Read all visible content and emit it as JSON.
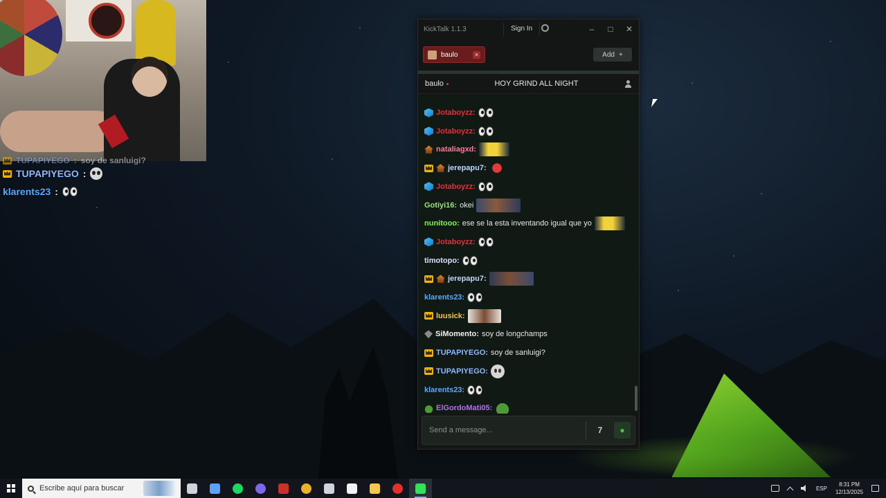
{
  "window": {
    "title": "KickTalk 1.1.3",
    "sign_in": "Sign In",
    "win_minimize": "–",
    "win_maximize": "□",
    "win_close": "✕"
  },
  "tabs": [
    {
      "label": "baulo",
      "close": "×"
    }
  ],
  "add_tab": {
    "label": "Add",
    "icon": "+"
  },
  "channel": {
    "name": "baulo",
    "stream_title": "HOY GRIND ALL NIGHT"
  },
  "messages": [
    {
      "user": "Jotaboyzz:",
      "color": "#e0313b",
      "badges": [
        "cube"
      ],
      "text": "",
      "emote": "eyes"
    },
    {
      "user": "Jotaboyzz:",
      "color": "#e0313b",
      "badges": [
        "cube"
      ],
      "text": "",
      "emote": "eyes"
    },
    {
      "user": "nataliagxd:",
      "color": "#ff7a9c",
      "badges": [
        "house"
      ],
      "text": "",
      "emote": "minion"
    },
    {
      "user": "jerepapu7:",
      "color": "#bcd7ff",
      "badges": [
        "crown",
        "house"
      ],
      "text": "",
      "emote": "red"
    },
    {
      "user": "Jotaboyzz:",
      "color": "#e0313b",
      "badges": [
        "cube"
      ],
      "text": "",
      "emote": "eyes"
    },
    {
      "user": "Gotiyi16:",
      "color": "#9de37a",
      "badges": [],
      "text": "okei",
      "emote": "photo"
    },
    {
      "user": "nunitooo:",
      "color": "#7cf54a",
      "badges": [],
      "text": "ese se la esta inventando igual que yo",
      "emote": "minion"
    },
    {
      "user": "Jotaboyzz:",
      "color": "#e0313b",
      "badges": [
        "cube"
      ],
      "text": "",
      "emote": "eyes"
    },
    {
      "user": "timotopo:",
      "color": "#d9e2ff",
      "badges": [],
      "text": "",
      "emote": "eyes"
    },
    {
      "user": "jerepapu7:",
      "color": "#bcd7ff",
      "badges": [
        "crown",
        "house"
      ],
      "text": "",
      "emote": "photo2"
    },
    {
      "user": "klarents23:",
      "color": "#5aa9ff",
      "badges": [],
      "text": "",
      "emote": "eyes"
    },
    {
      "user": "luusick:",
      "color": "#f5c542",
      "badges": [
        "crown"
      ],
      "text": "",
      "emote": "facephoto"
    },
    {
      "user": "SiMomento:",
      "color": "#f2f2f2",
      "badges": [
        "gem"
      ],
      "text": "soy de longchamps",
      "emote": ""
    },
    {
      "user": "TUPAPIYEGO:",
      "color": "#8fb9ff",
      "badges": [
        "crown"
      ],
      "text": "soy de sanluigi?",
      "emote": ""
    },
    {
      "user": "TUPAPIYEGO:",
      "color": "#8fb9ff",
      "badges": [
        "crown"
      ],
      "text": "",
      "emote": "ghost"
    },
    {
      "user": "klarents23:",
      "color": "#5aa9ff",
      "badges": [],
      "text": "",
      "emote": "eyes"
    },
    {
      "user": "ElGordoMati05:",
      "color": "#b86cf2",
      "badges": [
        "frog"
      ],
      "text": "",
      "emote": "frog"
    }
  ],
  "input": {
    "placeholder": "Send a message..."
  },
  "overlay_chat": [
    {
      "user": "TUPAPIYEGO",
      "sep": " : ",
      "text": "soy de sanluigi?",
      "color": "#8fb9ff",
      "faded": true
    },
    {
      "user": "TUPAPIYEGO",
      "sep": " : ",
      "text": "",
      "color": "#8fb9ff",
      "faded": false
    },
    {
      "user": "klarents23",
      "sep": " : ",
      "text": "",
      "color": "#5aa9ff",
      "faded": false
    }
  ],
  "taskbar": {
    "search_placeholder": "Escribe aquí para buscar",
    "apps": [
      {
        "name": "task-view",
        "color": "#cfd3da"
      },
      {
        "name": "copilot",
        "color": "#5aa2ff"
      },
      {
        "name": "spotify",
        "color": "#1ed760"
      },
      {
        "name": "discord",
        "color": "#7b68ee"
      },
      {
        "name": "video-app",
        "color": "#c8312a"
      },
      {
        "name": "chrome",
        "color": "#e8b32a"
      },
      {
        "name": "obs",
        "color": "#cfd3da"
      },
      {
        "name": "tiktok",
        "color": "#f2f2f2"
      },
      {
        "name": "file-explorer",
        "color": "#f2c94c"
      },
      {
        "name": "opera",
        "color": "#e0312b"
      },
      {
        "name": "kicktalk",
        "color": "#36e05a"
      }
    ],
    "active_app": "kicktalk",
    "lang": "ESP",
    "time": "8:31 PM",
    "date": "12/13/2025"
  }
}
